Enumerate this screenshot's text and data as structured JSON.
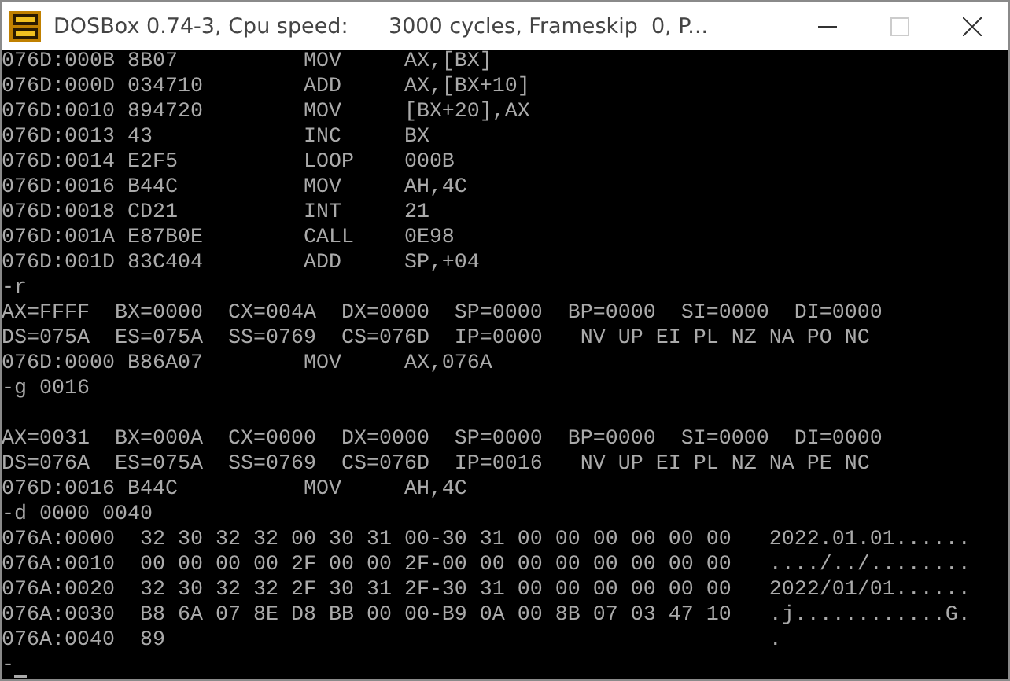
{
  "window": {
    "title": "DOSBox 0.74-3, Cpu speed:      3000 cycles, Frameskip  0, P...",
    "maximize_disabled": true
  },
  "console": {
    "lines": [
      {
        "kind": "text",
        "text": "076D:000B 8B07          MOV     AX,[BX]"
      },
      {
        "kind": "text",
        "text": "076D:000D 034710        ADD     AX,[BX+10]"
      },
      {
        "kind": "text",
        "text": "076D:0010 894720        MOV     [BX+20],AX"
      },
      {
        "kind": "text",
        "text": "076D:0013 43            INC     BX"
      },
      {
        "kind": "text",
        "text": "076D:0014 E2F5          LOOP    000B"
      },
      {
        "kind": "text",
        "text": "076D:0016 B44C          MOV     AH,4C"
      },
      {
        "kind": "text",
        "text": "076D:0018 CD21          INT     21"
      },
      {
        "kind": "text",
        "text": "076D:001A E87B0E        CALL    0E98"
      },
      {
        "kind": "text",
        "text": "076D:001D 83C404        ADD     SP,+04"
      },
      {
        "kind": "text",
        "text": "-r"
      },
      {
        "kind": "text",
        "text": "AX=FFFF  BX=0000  CX=004A  DX=0000  SP=0000  BP=0000  SI=0000  DI=0000"
      },
      {
        "kind": "text",
        "text": "DS=075A  ES=075A  SS=0769  CS=076D  IP=0000   NV UP EI PL NZ NA PO NC"
      },
      {
        "kind": "text",
        "text": "076D:0000 B86A07        MOV     AX,076A"
      },
      {
        "kind": "text",
        "text": "-g 0016"
      },
      {
        "kind": "blank"
      },
      {
        "kind": "text",
        "text": "AX=0031  BX=000A  CX=0000  DX=0000  SP=0000  BP=0000  SI=0000  DI=0000"
      },
      {
        "kind": "text",
        "text": "DS=076A  ES=075A  SS=0769  CS=076D  IP=0016   NV UP EI PL NZ NA PE NC"
      },
      {
        "kind": "text",
        "text": "076D:0016 B44C          MOV     AH,4C"
      },
      {
        "kind": "text",
        "text": "-d 0000 0040"
      },
      {
        "kind": "text",
        "text": "076A:0000  32 30 32 32 00 30 31 00-30 31 00 00 00 00 00 00   2022.01.01......"
      },
      {
        "kind": "text",
        "text": "076A:0010  00 00 00 00 2F 00 00 2F-00 00 00 00 00 00 00 00   ..../../........"
      },
      {
        "kind": "text",
        "text": "076A:0020  32 30 32 32 2F 30 31 2F-30 31 00 00 00 00 00 00   2022/01/01......"
      },
      {
        "kind": "text",
        "text": "076A:0030  B8 6A 07 8E D8 BB 00 00-B9 0A 00 8B 07 03 47 10   .j............G."
      },
      {
        "kind": "text",
        "text": "076A:0040  89                                                ."
      },
      {
        "kind": "prompt",
        "text": "-"
      }
    ]
  }
}
